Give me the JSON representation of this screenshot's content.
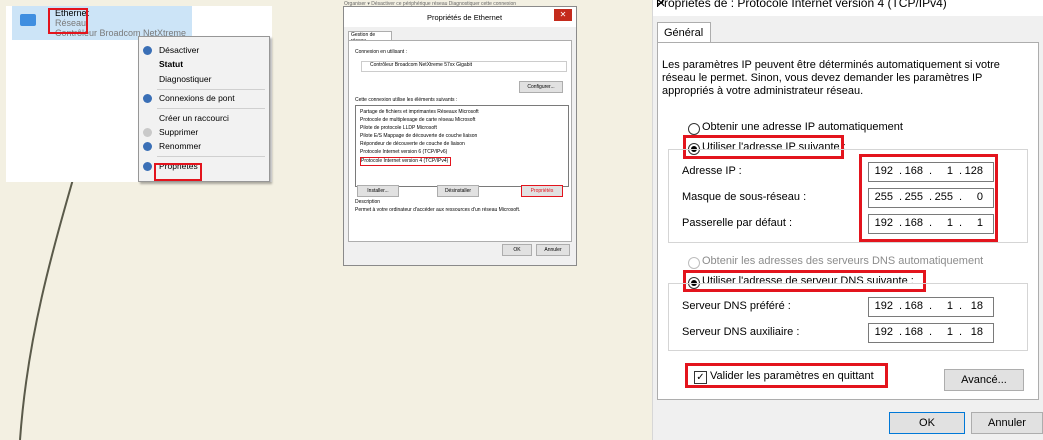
{
  "panel1": {
    "adapter": {
      "name": "Ethernet",
      "network": "Réseau",
      "device": "Contrôleur Broadcom NetXtreme"
    },
    "menu": [
      "Désactiver",
      "Statut",
      "Diagnostiquer",
      "Connexions de pont",
      "Créer un raccourci",
      "Supprimer",
      "Renommer",
      "Propriétés"
    ]
  },
  "panel2": {
    "toolbar": "Organiser ▾     Désactiver ce périphérique réseau     Diagnostiquer cette connexion",
    "title": "Propriétés de Ethernet",
    "tab": "Gestion de réseau",
    "connect_using": "Connexion en utilisant :",
    "adapter": "Contrôleur Broadcom NetXtreme 57xx Gigabit",
    "configure": "Configurer...",
    "items_heading": "Cette connexion utilise les éléments suivants :",
    "items": [
      "Partage de fichiers et imprimantes Réseaux Microsoft",
      "Protocole de multiplexage de carte réseau Microsoft",
      "Pilote de protocole LLDP Microsoft",
      "Pilote E/S Mappage de découverte de couche liaison",
      "Répondeur de découverte de couche de liaison",
      "Protocole Internet version 6 (TCP/IPv6)",
      "Protocole Internet version 4 (TCP/IPv4)"
    ],
    "install": "Installer...",
    "uninstall": "Désinstaller",
    "properties": "Propriétés",
    "description_label": "Description",
    "description": "Permet à votre ordinateur d'accéder aux ressources d'un réseau Microsoft.",
    "ok": "OK",
    "cancel": "Annuler"
  },
  "dialog": {
    "title": "Propriétés de : Protocole Internet version 4 (TCP/IPv4)",
    "close": "✕",
    "tab": "Général",
    "intro": "Les paramètres IP peuvent être déterminés automatiquement si votre réseau le permet. Sinon, vous devez demander les paramètres IP appropriés à votre administrateur réseau.",
    "ip_auto": "Obtenir une adresse IP automatiquement",
    "ip_manual": "Utiliser l'adresse IP suivante :",
    "ip_label": "Adresse IP :",
    "mask_label": "Masque de sous-réseau :",
    "gateway_label": "Passerelle par défaut :",
    "ip": [
      "192",
      "168",
      "1",
      "128"
    ],
    "mask": [
      "255",
      "255",
      "255",
      "0"
    ],
    "gateway": [
      "192",
      "168",
      "1",
      "1"
    ],
    "dns_auto": "Obtenir les adresses des serveurs DNS automatiquement",
    "dns_manual": "Utiliser l'adresse de serveur DNS suivante :",
    "dns1_label": "Serveur DNS préféré :",
    "dns2_label": "Serveur DNS auxiliaire :",
    "dns1": [
      "192",
      "168",
      "1",
      "18"
    ],
    "dns2": [
      "192",
      "168",
      "1",
      "18"
    ],
    "validate": "Valider les paramètres en quittant",
    "validate_checked": true,
    "advanced": "Avancé...",
    "ok": "OK",
    "cancel": "Annuler"
  },
  "colors": {
    "highlight": "#e3141d",
    "selection": "#cce4f7"
  }
}
